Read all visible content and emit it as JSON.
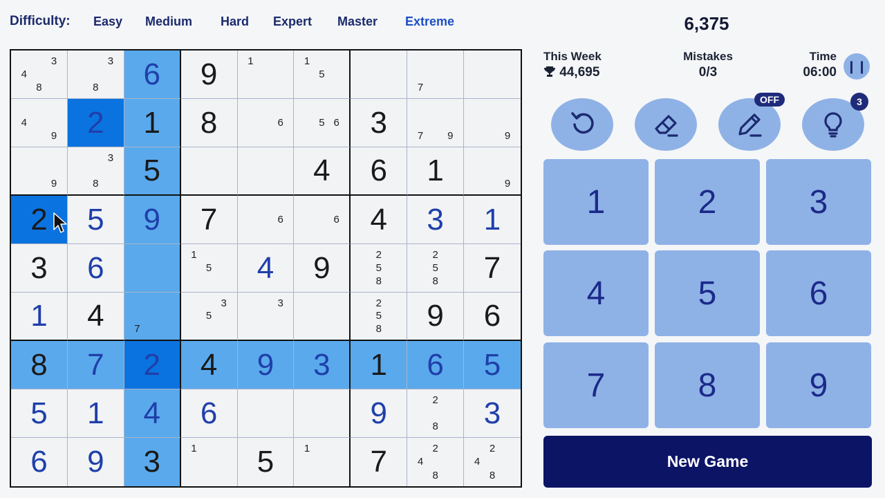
{
  "header": {
    "difficulty_label": "Difficulty:",
    "difficulties": [
      "Easy",
      "Medium",
      "Hard",
      "Expert",
      "Master",
      "Extreme"
    ],
    "active_difficulty": "Extreme",
    "score": "6,375"
  },
  "stats": {
    "week_label": "This Week",
    "week_value": "44,695",
    "mistakes_label": "Mistakes",
    "mistakes_value": "0/3",
    "time_label": "Time",
    "time_value": "06:00",
    "pause_icon": "pause-icon"
  },
  "tools": {
    "undo_icon": "undo-icon",
    "erase_icon": "eraser-icon",
    "notes_icon": "pencil-icon",
    "notes_badge": "OFF",
    "hint_icon": "lightbulb-icon",
    "hint_badge": "3"
  },
  "numpad": [
    "1",
    "2",
    "3",
    "4",
    "5",
    "6",
    "7",
    "8",
    "9"
  ],
  "new_game_label": "New Game",
  "colors": {
    "highlight": "#5aa9ec",
    "selected": "#0b73e0",
    "pad": "#8fb2e6",
    "new_game_bg": "#0c1466"
  },
  "board": {
    "selected_cell": [
      3,
      0
    ],
    "rows": [
      [
        {
          "n": [
            4,
            8,
            3
          ]
        },
        {
          "n": [
            3,
            8
          ]
        },
        {
          "v": 6,
          "u": true
        },
        {
          "v": 9
        },
        {
          "n": [
            1
          ]
        },
        {
          "n": [
            1,
            5
          ]
        },
        {
          "n": []
        },
        {
          "n": [
            7
          ]
        },
        {
          "n": []
        }
      ],
      [
        {
          "n": [
            4,
            9
          ]
        },
        {
          "v": 2,
          "u": true
        },
        {
          "v": 1
        },
        {
          "v": 8
        },
        {
          "n": [
            6
          ]
        },
        {
          "n": [
            5,
            6
          ]
        },
        {
          "v": 3
        },
        {
          "n": [
            7,
            9
          ]
        },
        {
          "n": [
            9
          ]
        }
      ],
      [
        {
          "n": [
            9
          ]
        },
        {
          "n": [
            3,
            8
          ]
        },
        {
          "v": 5
        },
        {
          "n": []
        },
        {
          "n": []
        },
        {
          "v": 4
        },
        {
          "v": 6
        },
        {
          "v": 1
        },
        {
          "n": [
            9
          ]
        }
      ],
      [
        {
          "v": 2
        },
        {
          "v": 5,
          "u": true
        },
        {
          "v": 9,
          "u": true
        },
        {
          "v": 7
        },
        {
          "n": [
            6
          ]
        },
        {
          "n": [
            6
          ]
        },
        {
          "v": 4
        },
        {
          "v": 3,
          "u": true
        },
        {
          "v": 1,
          "u": true
        }
      ],
      [
        {
          "v": 3
        },
        {
          "v": 6,
          "u": true
        },
        {
          "n": []
        },
        {
          "n": [
            1,
            5
          ]
        },
        {
          "v": 4,
          "u": true
        },
        {
          "v": 9
        },
        {
          "n": [
            2,
            5,
            8
          ]
        },
        {
          "n": [
            2,
            5,
            8
          ]
        },
        {
          "v": 7
        }
      ],
      [
        {
          "v": 1,
          "u": true
        },
        {
          "v": 4
        },
        {
          "n": [
            7
          ]
        },
        {
          "n": [
            3,
            5
          ]
        },
        {
          "n": [
            3
          ]
        },
        {
          "n": []
        },
        {
          "n": [
            2,
            5,
            8
          ]
        },
        {
          "v": 9
        },
        {
          "v": 6
        }
      ],
      [
        {
          "v": 8
        },
        {
          "v": 7,
          "u": true
        },
        {
          "v": 2,
          "u": true
        },
        {
          "v": 4
        },
        {
          "v": 9,
          "u": true
        },
        {
          "v": 3,
          "u": true
        },
        {
          "v": 1
        },
        {
          "v": 6,
          "u": true
        },
        {
          "v": 5,
          "u": true
        }
      ],
      [
        {
          "v": 5,
          "u": true
        },
        {
          "v": 1,
          "u": true
        },
        {
          "v": 4,
          "u": true
        },
        {
          "v": 6,
          "u": true
        },
        {
          "n": []
        },
        {
          "n": []
        },
        {
          "v": 9,
          "u": true
        },
        {
          "n": [
            2,
            8
          ]
        },
        {
          "v": 3,
          "u": true
        }
      ],
      [
        {
          "v": 6,
          "u": true
        },
        {
          "v": 9,
          "u": true
        },
        {
          "v": 3
        },
        {
          "n": [
            1
          ]
        },
        {
          "v": 5
        },
        {
          "n": [
            1
          ]
        },
        {
          "v": 7
        },
        {
          "n": [
            2,
            4,
            8
          ]
        },
        {
          "n": [
            2,
            4,
            8
          ]
        }
      ]
    ]
  }
}
